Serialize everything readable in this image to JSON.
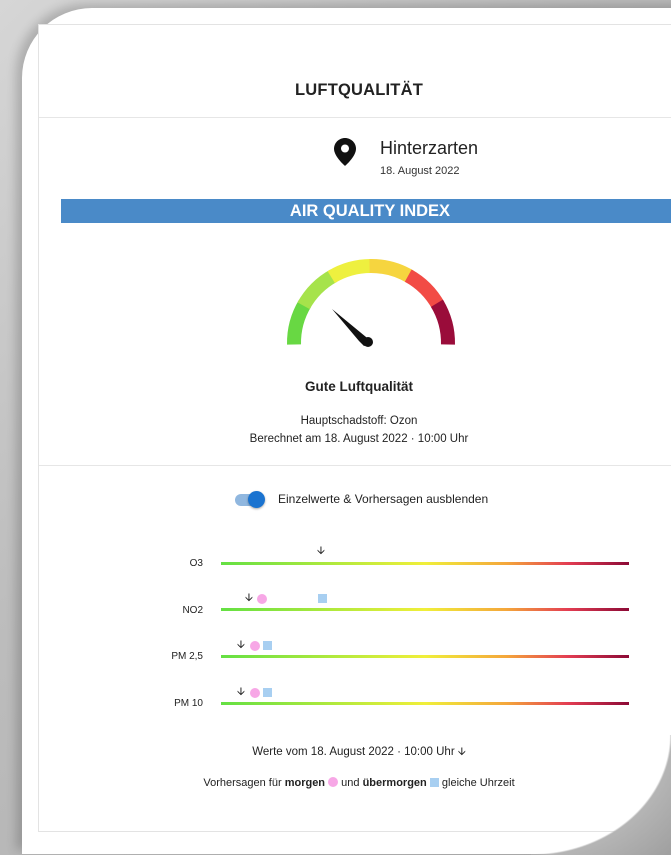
{
  "header": {
    "title": "LUFTQUALITÄT"
  },
  "location": {
    "name": "Hinterzarten",
    "date": "18. August 2022",
    "icon": "map-pin-icon"
  },
  "aqi": {
    "banner": "AIR QUALITY INDEX",
    "verdict": "Gute Luftqualität",
    "main_pollutant": "Hauptschadstoff: Ozon",
    "calculated": "Berechnet am 18. August 2022 · 10:00 Uhr",
    "gauge_colors": [
      "#68d843",
      "#a6e34b",
      "#eef03f",
      "#f6d53f",
      "#f24b45",
      "#9a0c3a"
    ]
  },
  "toggle": {
    "label": "Einzelwerte & Vorhersagen ausblenden",
    "on": true
  },
  "pollutants": [
    {
      "name": "O3"
    },
    {
      "name": "NO2"
    },
    {
      "name": "PM 2,5"
    },
    {
      "name": "PM 10"
    }
  ],
  "footer": {
    "values_from": "Werte vom 18. August 2022 · 10:00 Uhr",
    "forecast_prefix": "Vorhersagen für",
    "tomorrow": "morgen",
    "and": "und",
    "day_after": "übermorgen",
    "same_time": "gleiche Uhrzeit"
  }
}
